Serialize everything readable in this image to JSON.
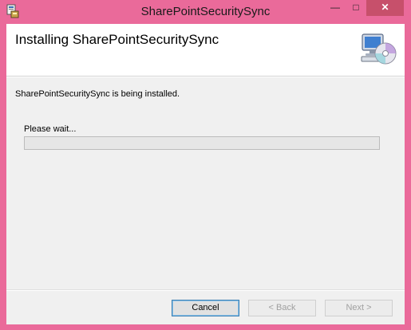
{
  "window": {
    "title": "SharePointSecuritySync",
    "minimize_label": "—",
    "maximize_label": "□",
    "close_label": "✕"
  },
  "banner": {
    "title": "Installing SharePointSecuritySync",
    "icon": "computer-disc-icon"
  },
  "body": {
    "status": "SharePointSecuritySync is being installed.",
    "wait_label": "Please wait...",
    "progress_fraction": 0.0
  },
  "buttons": {
    "cancel": "Cancel",
    "back": "< Back",
    "next": "Next >"
  },
  "colors": {
    "frame": "#ea6a9a",
    "client": "#f0f0f0",
    "banner": "#ffffff"
  }
}
